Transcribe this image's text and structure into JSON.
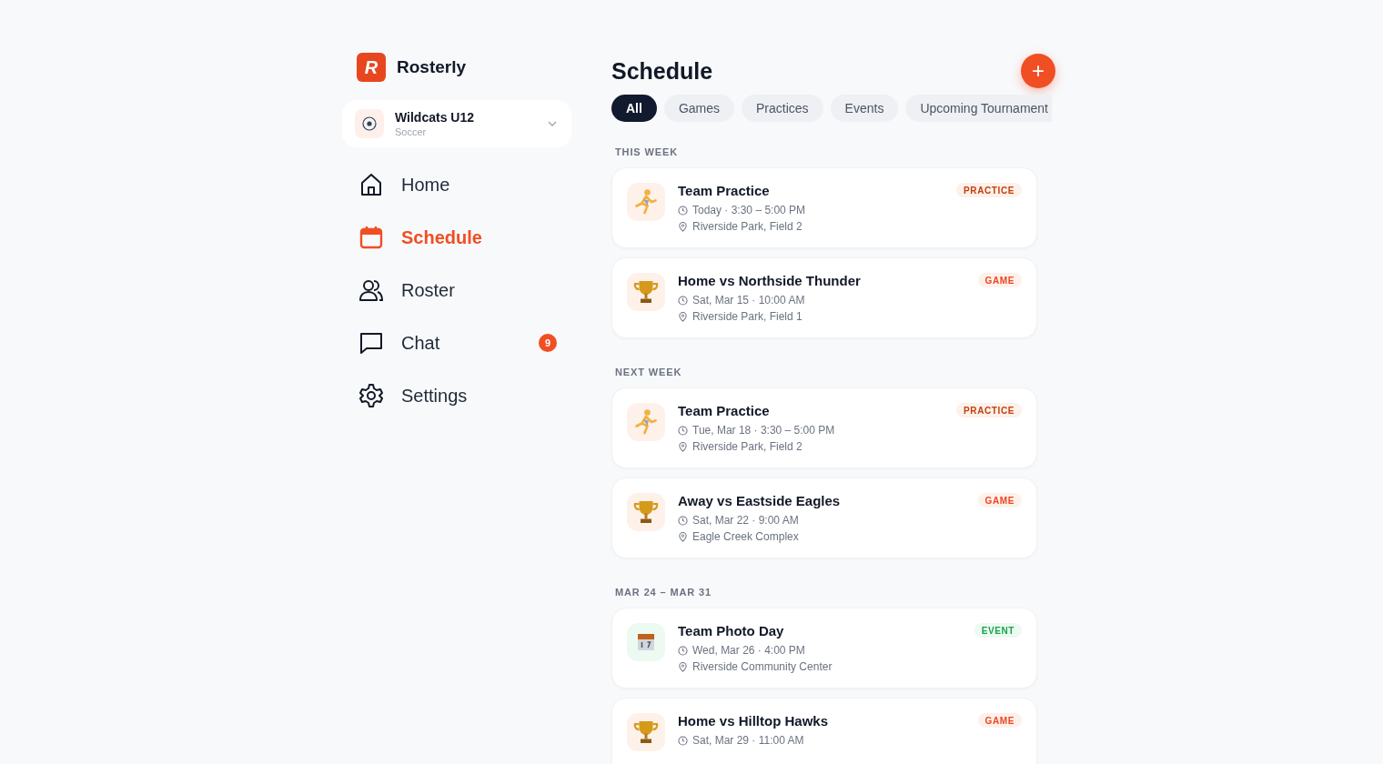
{
  "brand": {
    "logo_letter": "R",
    "name": "Rosterly"
  },
  "team": {
    "name": "Wildcats U12",
    "sport": "Soccer"
  },
  "nav": [
    {
      "label": "Home",
      "kind": "home",
      "selected": false
    },
    {
      "label": "Schedule",
      "kind": "calendar",
      "selected": true
    },
    {
      "label": "Roster",
      "kind": "people",
      "selected": false
    },
    {
      "label": "Chat",
      "kind": "chat",
      "selected": false,
      "badge": "9"
    },
    {
      "label": "Settings",
      "kind": "gear",
      "selected": false
    }
  ],
  "page_title": "Schedule",
  "add_button": "+",
  "filters": [
    {
      "label": "All",
      "selected": true
    },
    {
      "label": "Games",
      "selected": false
    },
    {
      "label": "Practices",
      "selected": false
    },
    {
      "label": "Events",
      "selected": false
    },
    {
      "label": "Upcoming Tournament",
      "selected": false
    }
  ],
  "sections": [
    {
      "heading": "THIS WEEK",
      "events": [
        {
          "kind": "practice",
          "title": "Team Practice",
          "time": "Today · 3:30 – 5:00 PM",
          "location": "Riverside Park, Field 2",
          "tag": "PRACTICE"
        },
        {
          "kind": "game",
          "title": "Home vs Northside Thunder",
          "time": "Sat, Mar 15 · 10:00 AM",
          "location": "Riverside Park, Field 1",
          "tag": "GAME"
        }
      ]
    },
    {
      "heading": "NEXT WEEK",
      "events": [
        {
          "kind": "practice",
          "title": "Team Practice",
          "time": "Tue, Mar 18 · 3:30 – 5:00 PM",
          "location": "Riverside Park, Field 2",
          "tag": "PRACTICE"
        },
        {
          "kind": "game",
          "title": "Away vs Eastside Eagles",
          "time": "Sat, Mar 22 · 9:00 AM",
          "location": "Eagle Creek Complex",
          "tag": "GAME"
        }
      ]
    },
    {
      "heading": "MAR 24 – MAR 31",
      "events": [
        {
          "kind": "event",
          "title": "Team Photo Day",
          "time": "Wed, Mar 26 · 4:00 PM",
          "location": "Riverside Community Center",
          "tag": "EVENT"
        },
        {
          "kind": "game",
          "title": "Home vs Hilltop Hawks",
          "time": "Sat, Mar 29 · 11:00 AM",
          "tag": "GAME"
        }
      ]
    }
  ]
}
